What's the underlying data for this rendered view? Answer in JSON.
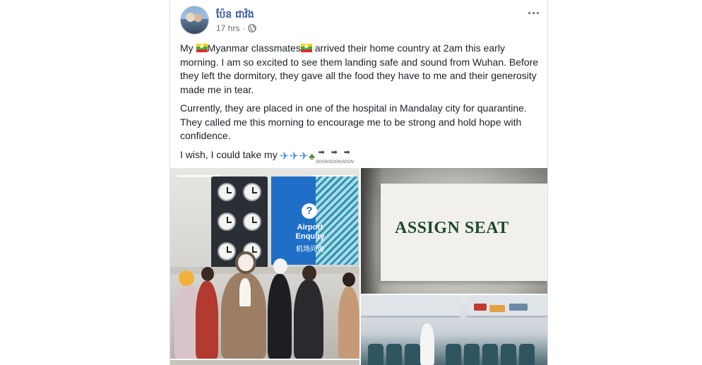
{
  "post": {
    "author": "ប៉ែន ជាវ៉ង",
    "time": "17 hrs",
    "separator": "·",
    "privacy_icon": "globe-icon",
    "more_icon": "more-options-icon",
    "paragraph1_pre": "My ",
    "paragraph1_mid": "Myanmar classmates",
    "paragraph1_post": " arrived their home country at 2am this early morning. I am so excited to see them landing safe and sound from Wuhan. Before they left the dormitory, they gave all the food they have to me and their generosity made me in tear.",
    "paragraph2": "Currently, they are placed in one of the hospital in Mandalay city for quarantine. They called me this morning to encourage me to be strong and hold hope with confidence.",
    "paragraph3": "I wish, I could take my ",
    "emoji_names": [
      "flag-myanmar-icon",
      "airplane-icon",
      "airplane-icon",
      "airplane-icon",
      "tree-icon",
      "soon-arrow-icon",
      "soon-arrow-icon",
      "soon-arrow-icon"
    ],
    "soon_label": "SOON"
  },
  "photos": {
    "airport_sign_label": "Airport Enquiry",
    "airport_sign_cn": "机场问询",
    "airport_sign_symbol": "?",
    "seat_sign": "ASSIGN SEAT"
  },
  "colors": {
    "author_link": "#385898",
    "meta_text": "#616770",
    "body_text": "#1d2129",
    "border": "#dddfe2"
  }
}
